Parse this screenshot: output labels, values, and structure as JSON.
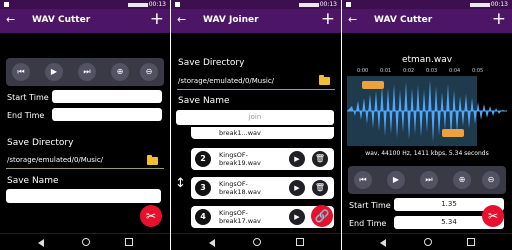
{
  "status_time": "00:13",
  "cutter": {
    "title": "WAV Cutter",
    "start_label": "Start Time",
    "end_label": "End Time",
    "save_dir_label": "Save Directory",
    "save_dir_path": "/storage/emulated/0/Music/",
    "save_name_label": "Save Name"
  },
  "joiner": {
    "title": "WAV Joiner",
    "save_dir_label": "Save Directory",
    "save_dir_path": "/storage/emulated/0/Music/",
    "save_name_label": "Save Name",
    "join_placeholder": "join",
    "partial_item": "break1...wav",
    "items": [
      {
        "num": "2",
        "name": "KingsOF-break19.wav"
      },
      {
        "num": "3",
        "name": "KingsOF-break18.wav"
      },
      {
        "num": "4",
        "name": "KingsOF-break17.wav"
      }
    ]
  },
  "editor": {
    "title": "WAV Cutter",
    "file_name": "etman.wav",
    "timeline_ticks": [
      "0:00",
      "0:01",
      "0:02",
      "0:03",
      "0:04",
      "0:05"
    ],
    "audio_info": "wav, 44100 Hz, 1411 kbps, 5.34 seconds",
    "start_label": "Start Time",
    "start_value": "1.35",
    "end_label": "End Time",
    "end_value": "5.34"
  },
  "icons": {
    "back": "arrow-back-icon",
    "add": "plus-icon",
    "prev": "skip-previous-icon",
    "play": "play-icon",
    "next": "skip-next-icon",
    "zoom_in": "zoom-in-icon",
    "zoom_out": "zoom-out-icon",
    "folder": "folder-icon",
    "cut": "scissors-icon",
    "join": "link-icon",
    "delete": "trash-icon"
  },
  "colors": {
    "app_bar": "#4d1565",
    "status_bar": "#3e0f4f",
    "fab": "#e8112d",
    "waveform": "#4aa8ff",
    "selection": "#e8a43a",
    "folder": "#f0c030"
  }
}
